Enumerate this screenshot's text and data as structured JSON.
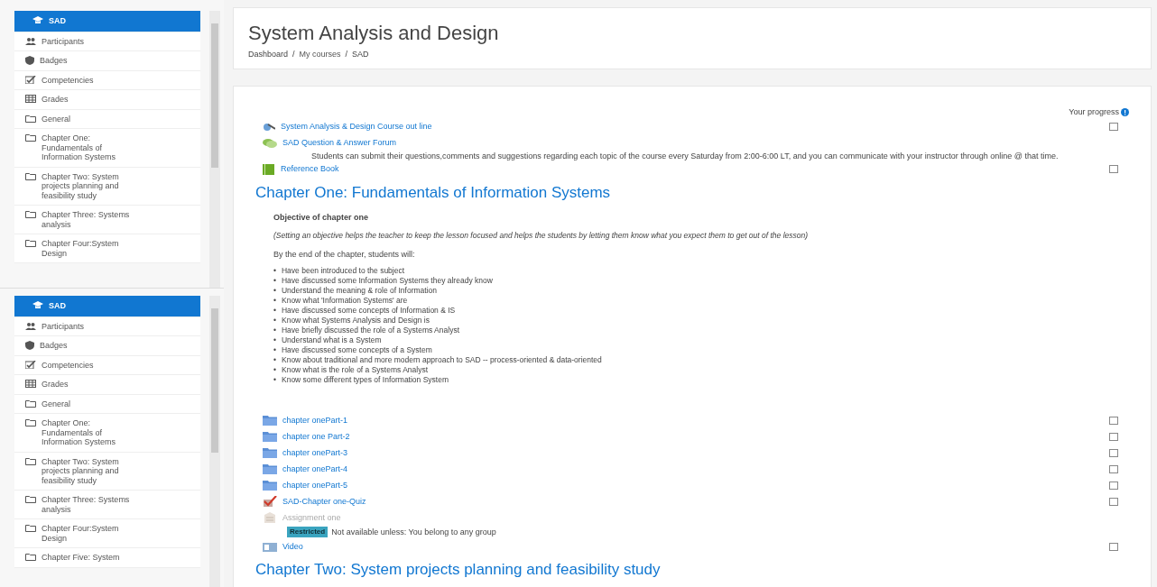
{
  "sidebars": [
    {
      "items": [
        {
          "kind": "course",
          "label": "SAD",
          "selected": true
        },
        {
          "kind": "people",
          "label": "Participants",
          "selected": false
        },
        {
          "kind": "badge",
          "label": "Badges",
          "selected": false
        },
        {
          "kind": "competency",
          "label": "Competencies",
          "selected": false
        },
        {
          "kind": "grades",
          "label": "Grades",
          "selected": false
        },
        {
          "kind": "section",
          "label": "General",
          "selected": false
        },
        {
          "kind": "section",
          "label": "Chapter One: Fundamentals of Information Systems",
          "selected": false
        },
        {
          "kind": "section",
          "label": "Chapter Two: System projects planning and feasibility study",
          "selected": false
        },
        {
          "kind": "section",
          "label": "Chapter Three: Systems analysis",
          "selected": false
        },
        {
          "kind": "section",
          "label": "Chapter Four:System Design",
          "selected": false
        }
      ]
    },
    {
      "items": [
        {
          "kind": "course",
          "label": "SAD",
          "selected": true
        },
        {
          "kind": "people",
          "label": "Participants",
          "selected": false
        },
        {
          "kind": "badge",
          "label": "Badges",
          "selected": false
        },
        {
          "kind": "competency",
          "label": "Competencies",
          "selected": false
        },
        {
          "kind": "grades",
          "label": "Grades",
          "selected": false
        },
        {
          "kind": "section",
          "label": "General",
          "selected": false
        },
        {
          "kind": "section",
          "label": "Chapter One: Fundamentals of Information Systems",
          "selected": false
        },
        {
          "kind": "section",
          "label": "Chapter Two: System projects planning and feasibility study",
          "selected": false
        },
        {
          "kind": "section",
          "label": "Chapter Three: Systems analysis",
          "selected": false
        },
        {
          "kind": "section",
          "label": "Chapter Four:System Design",
          "selected": false
        },
        {
          "kind": "section",
          "label": "Chapter Five: System",
          "selected": false
        }
      ]
    }
  ],
  "header": {
    "title": "System Analysis and Design",
    "breadcrumb": [
      "Dashboard",
      "My courses",
      "SAD"
    ],
    "separator": "/"
  },
  "progress": {
    "label": "Your progress"
  },
  "sections": [
    {
      "activities": [
        {
          "kind": "url",
          "label": "System Analysis & Design Course out line",
          "disabled": false,
          "completion": {
            "checked": false
          }
        },
        {
          "kind": "forum",
          "label": "SAD Question & Answer Forum",
          "disabled": false,
          "description": "Students can submit their questions,comments and suggestions regarding each topic of the course every Saturday from 2:00-6:00 LT, and  you can communicate with your instructor through online @ that time."
        },
        {
          "kind": "book",
          "label": "Reference Book",
          "disabled": false,
          "completion": {
            "checked": false
          }
        }
      ]
    },
    {
      "title": "Chapter One: Fundamentals of Information Systems",
      "summary": {
        "bullet": "•",
        "heading": "Objective of chapter one",
        "note": "(Setting an objective helps the teacher to keep the lesson focused and helps the students by letting them know what you expect them to get out of the lesson)",
        "intro": "By the end of the chapter, students will:",
        "bullets": [
          "Have been introduced to the subject",
          "Have discussed some Information Systems they already know",
          "Understand the meaning & role of Information",
          "Know what 'Information Systems' are",
          "Have discussed some concepts of Information  & IS",
          "Know what Systems Analysis and Design is",
          "Have briefly discussed the role of a Systems Analyst",
          "Understand what is a System",
          "Have discussed some concepts of a System",
          "Know about traditional and more modern approach to SAD -- process-oriented & data-oriented",
          "Know what is the role of a Systems Analyst",
          "Know some different types of Information System"
        ]
      },
      "activities": [
        {
          "kind": "folder",
          "label": "chapter onePart-1",
          "disabled": false,
          "completion": {
            "checked": false
          }
        },
        {
          "kind": "folder",
          "label": "chapter one Part-2",
          "disabled": false,
          "completion": {
            "checked": false
          }
        },
        {
          "kind": "folder",
          "label": "chapter onePart-3",
          "disabled": false,
          "completion": {
            "checked": false
          }
        },
        {
          "kind": "folder",
          "label": "chapter onePart-4",
          "disabled": false,
          "completion": {
            "checked": false
          }
        },
        {
          "kind": "folder",
          "label": "chapter onePart-5",
          "disabled": false,
          "completion": {
            "checked": false
          }
        },
        {
          "kind": "quiz",
          "label": "SAD-Chapter one-Quiz",
          "disabled": false,
          "completion": {
            "checked": false
          }
        },
        {
          "kind": "assignment",
          "label": "Assignment one",
          "disabled": true,
          "restriction": {
            "badge": "Restricted",
            "text": "Not available unless: You belong to any group"
          }
        },
        {
          "kind": "video",
          "label": "Video",
          "disabled": false,
          "completion": {
            "checked": false
          }
        }
      ]
    },
    {
      "title": "Chapter Two: System projects planning and feasibility study"
    }
  ]
}
